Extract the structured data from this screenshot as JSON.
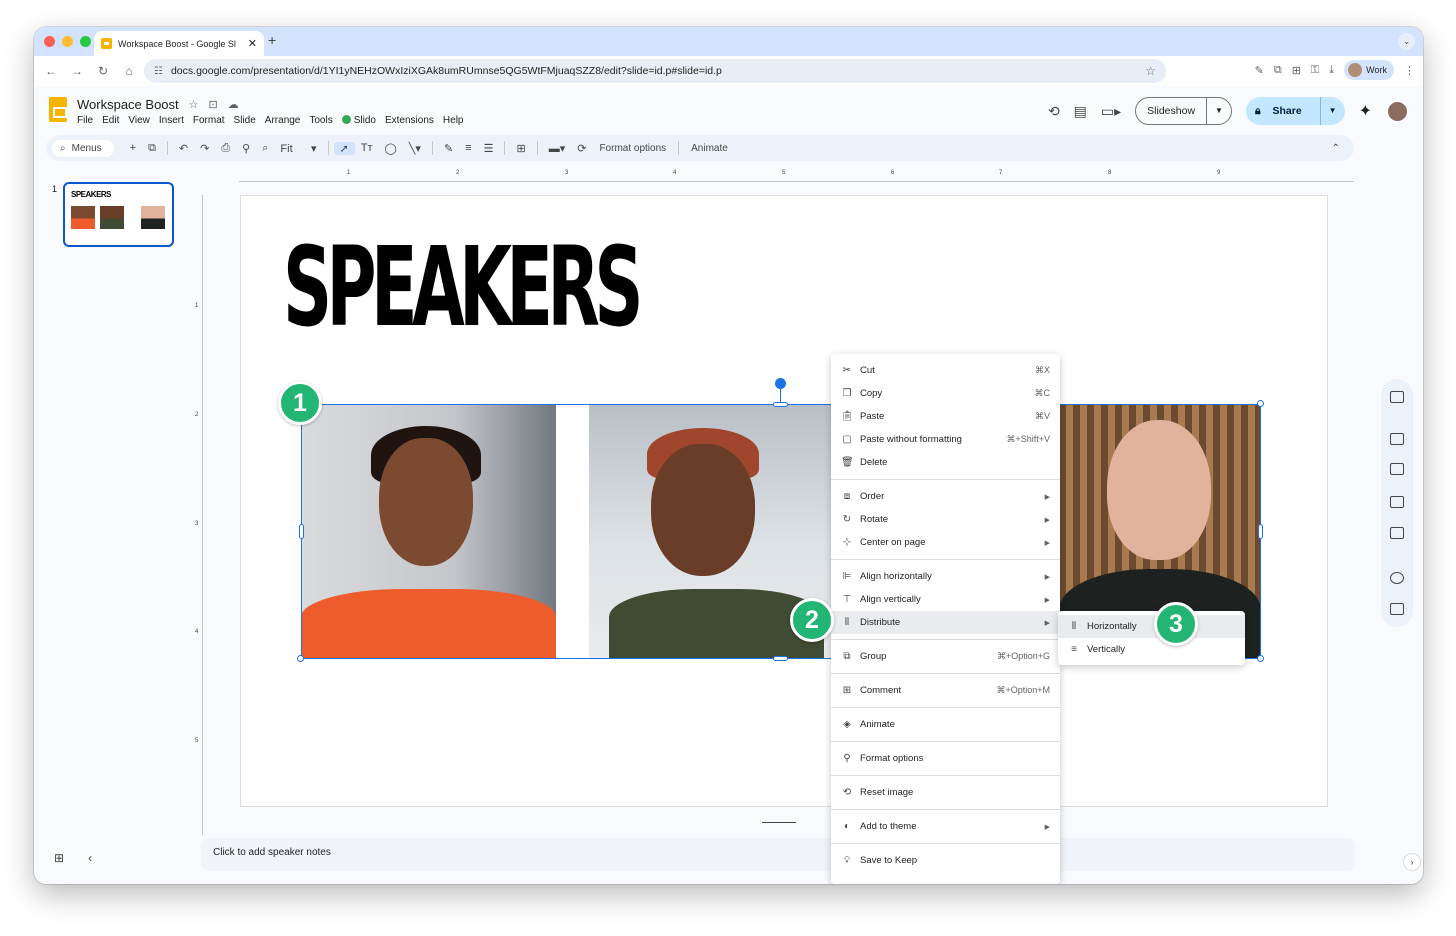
{
  "browser": {
    "tab_title": "Workspace Boost - Google Sl",
    "url": "docs.google.com/presentation/d/1YI1yNEHzOWxIziXGAk8umRUmnse5QG5WtFMjuaqSZZ8/edit?slide=id.p#slide=id.p",
    "profile_label": "Work",
    "traffic_colors": [
      "#ff5f57",
      "#febc2e",
      "#28c840"
    ]
  },
  "doc": {
    "title": "Workspace Boost",
    "menus": [
      "File",
      "Edit",
      "View",
      "Insert",
      "Format",
      "Slide",
      "Arrange",
      "Tools",
      "Slido",
      "Extensions",
      "Help"
    ],
    "slideshow_label": "Slideshow",
    "share_label": "Share"
  },
  "toolbar": {
    "menus_label": "Menus",
    "zoom_label": "Fit",
    "format_options_label": "Format options",
    "animate_label": "Animate"
  },
  "filmstrip": {
    "slide_number": "1",
    "thumb_title": "SPEAKERS"
  },
  "ruler": {
    "top_numbers": [
      "1",
      "2",
      "3",
      "4",
      "5",
      "6",
      "7",
      "8",
      "9"
    ],
    "left_numbers": [
      "1",
      "2",
      "3",
      "4",
      "5"
    ]
  },
  "slide": {
    "title": "SPEAKERS"
  },
  "badges": [
    "1",
    "2",
    "3"
  ],
  "context_menu": {
    "cut": {
      "label": "Cut",
      "shortcut": "⌘X"
    },
    "copy": {
      "label": "Copy",
      "shortcut": "⌘C"
    },
    "paste": {
      "label": "Paste",
      "shortcut": "⌘V"
    },
    "paste_plain": {
      "label": "Paste without formatting",
      "shortcut": "⌘+Shift+V"
    },
    "delete": {
      "label": "Delete"
    },
    "order": {
      "label": "Order"
    },
    "rotate": {
      "label": "Rotate"
    },
    "center": {
      "label": "Center on page"
    },
    "align_h": {
      "label": "Align horizontally"
    },
    "align_v": {
      "label": "Align vertically"
    },
    "distribute": {
      "label": "Distribute"
    },
    "group": {
      "label": "Group",
      "shortcut": "⌘+Option+G"
    },
    "comment": {
      "label": "Comment",
      "shortcut": "⌘+Option+M"
    },
    "animate": {
      "label": "Animate"
    },
    "format_options": {
      "label": "Format options"
    },
    "reset_image": {
      "label": "Reset image"
    },
    "add_theme": {
      "label": "Add to theme"
    },
    "save_keep": {
      "label": "Save to Keep"
    }
  },
  "submenu": {
    "horizontally": "Horizontally",
    "vertically": "Vertically"
  },
  "notes": {
    "placeholder": "Click to add speaker notes"
  },
  "colors": {
    "accent": "#1a73e8",
    "badge": "#22b573",
    "slides_yellow": "#f4b400"
  }
}
